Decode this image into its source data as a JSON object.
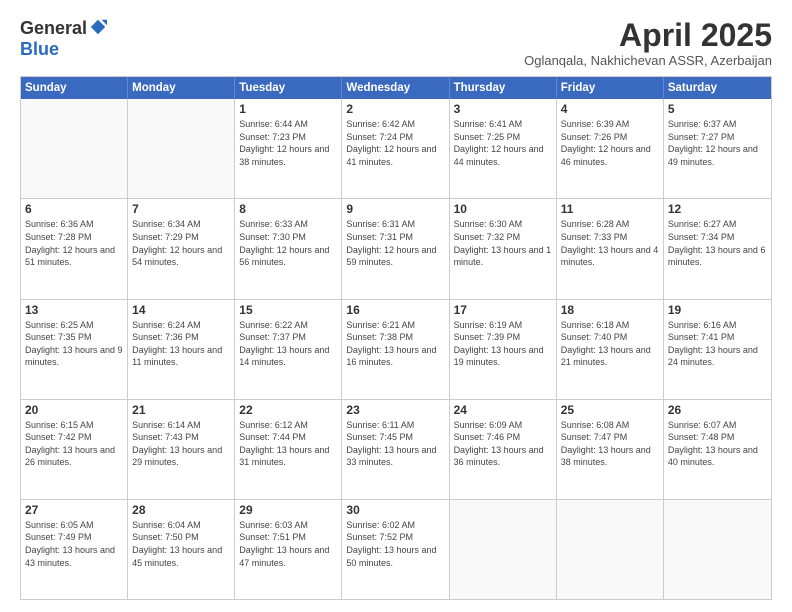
{
  "header": {
    "logo_general": "General",
    "logo_blue": "Blue",
    "month_title": "April 2025",
    "subtitle": "Oglanqala, Nakhichevan ASSR, Azerbaijan"
  },
  "weekdays": [
    "Sunday",
    "Monday",
    "Tuesday",
    "Wednesday",
    "Thursday",
    "Friday",
    "Saturday"
  ],
  "weeks": [
    [
      {
        "day": "",
        "info": ""
      },
      {
        "day": "",
        "info": ""
      },
      {
        "day": "1",
        "info": "Sunrise: 6:44 AM\nSunset: 7:23 PM\nDaylight: 12 hours and 38 minutes."
      },
      {
        "day": "2",
        "info": "Sunrise: 6:42 AM\nSunset: 7:24 PM\nDaylight: 12 hours and 41 minutes."
      },
      {
        "day": "3",
        "info": "Sunrise: 6:41 AM\nSunset: 7:25 PM\nDaylight: 12 hours and 44 minutes."
      },
      {
        "day": "4",
        "info": "Sunrise: 6:39 AM\nSunset: 7:26 PM\nDaylight: 12 hours and 46 minutes."
      },
      {
        "day": "5",
        "info": "Sunrise: 6:37 AM\nSunset: 7:27 PM\nDaylight: 12 hours and 49 minutes."
      }
    ],
    [
      {
        "day": "6",
        "info": "Sunrise: 6:36 AM\nSunset: 7:28 PM\nDaylight: 12 hours and 51 minutes."
      },
      {
        "day": "7",
        "info": "Sunrise: 6:34 AM\nSunset: 7:29 PM\nDaylight: 12 hours and 54 minutes."
      },
      {
        "day": "8",
        "info": "Sunrise: 6:33 AM\nSunset: 7:30 PM\nDaylight: 12 hours and 56 minutes."
      },
      {
        "day": "9",
        "info": "Sunrise: 6:31 AM\nSunset: 7:31 PM\nDaylight: 12 hours and 59 minutes."
      },
      {
        "day": "10",
        "info": "Sunrise: 6:30 AM\nSunset: 7:32 PM\nDaylight: 13 hours and 1 minute."
      },
      {
        "day": "11",
        "info": "Sunrise: 6:28 AM\nSunset: 7:33 PM\nDaylight: 13 hours and 4 minutes."
      },
      {
        "day": "12",
        "info": "Sunrise: 6:27 AM\nSunset: 7:34 PM\nDaylight: 13 hours and 6 minutes."
      }
    ],
    [
      {
        "day": "13",
        "info": "Sunrise: 6:25 AM\nSunset: 7:35 PM\nDaylight: 13 hours and 9 minutes."
      },
      {
        "day": "14",
        "info": "Sunrise: 6:24 AM\nSunset: 7:36 PM\nDaylight: 13 hours and 11 minutes."
      },
      {
        "day": "15",
        "info": "Sunrise: 6:22 AM\nSunset: 7:37 PM\nDaylight: 13 hours and 14 minutes."
      },
      {
        "day": "16",
        "info": "Sunrise: 6:21 AM\nSunset: 7:38 PM\nDaylight: 13 hours and 16 minutes."
      },
      {
        "day": "17",
        "info": "Sunrise: 6:19 AM\nSunset: 7:39 PM\nDaylight: 13 hours and 19 minutes."
      },
      {
        "day": "18",
        "info": "Sunrise: 6:18 AM\nSunset: 7:40 PM\nDaylight: 13 hours and 21 minutes."
      },
      {
        "day": "19",
        "info": "Sunrise: 6:16 AM\nSunset: 7:41 PM\nDaylight: 13 hours and 24 minutes."
      }
    ],
    [
      {
        "day": "20",
        "info": "Sunrise: 6:15 AM\nSunset: 7:42 PM\nDaylight: 13 hours and 26 minutes."
      },
      {
        "day": "21",
        "info": "Sunrise: 6:14 AM\nSunset: 7:43 PM\nDaylight: 13 hours and 29 minutes."
      },
      {
        "day": "22",
        "info": "Sunrise: 6:12 AM\nSunset: 7:44 PM\nDaylight: 13 hours and 31 minutes."
      },
      {
        "day": "23",
        "info": "Sunrise: 6:11 AM\nSunset: 7:45 PM\nDaylight: 13 hours and 33 minutes."
      },
      {
        "day": "24",
        "info": "Sunrise: 6:09 AM\nSunset: 7:46 PM\nDaylight: 13 hours and 36 minutes."
      },
      {
        "day": "25",
        "info": "Sunrise: 6:08 AM\nSunset: 7:47 PM\nDaylight: 13 hours and 38 minutes."
      },
      {
        "day": "26",
        "info": "Sunrise: 6:07 AM\nSunset: 7:48 PM\nDaylight: 13 hours and 40 minutes."
      }
    ],
    [
      {
        "day": "27",
        "info": "Sunrise: 6:05 AM\nSunset: 7:49 PM\nDaylight: 13 hours and 43 minutes."
      },
      {
        "day": "28",
        "info": "Sunrise: 6:04 AM\nSunset: 7:50 PM\nDaylight: 13 hours and 45 minutes."
      },
      {
        "day": "29",
        "info": "Sunrise: 6:03 AM\nSunset: 7:51 PM\nDaylight: 13 hours and 47 minutes."
      },
      {
        "day": "30",
        "info": "Sunrise: 6:02 AM\nSunset: 7:52 PM\nDaylight: 13 hours and 50 minutes."
      },
      {
        "day": "",
        "info": ""
      },
      {
        "day": "",
        "info": ""
      },
      {
        "day": "",
        "info": ""
      }
    ]
  ]
}
